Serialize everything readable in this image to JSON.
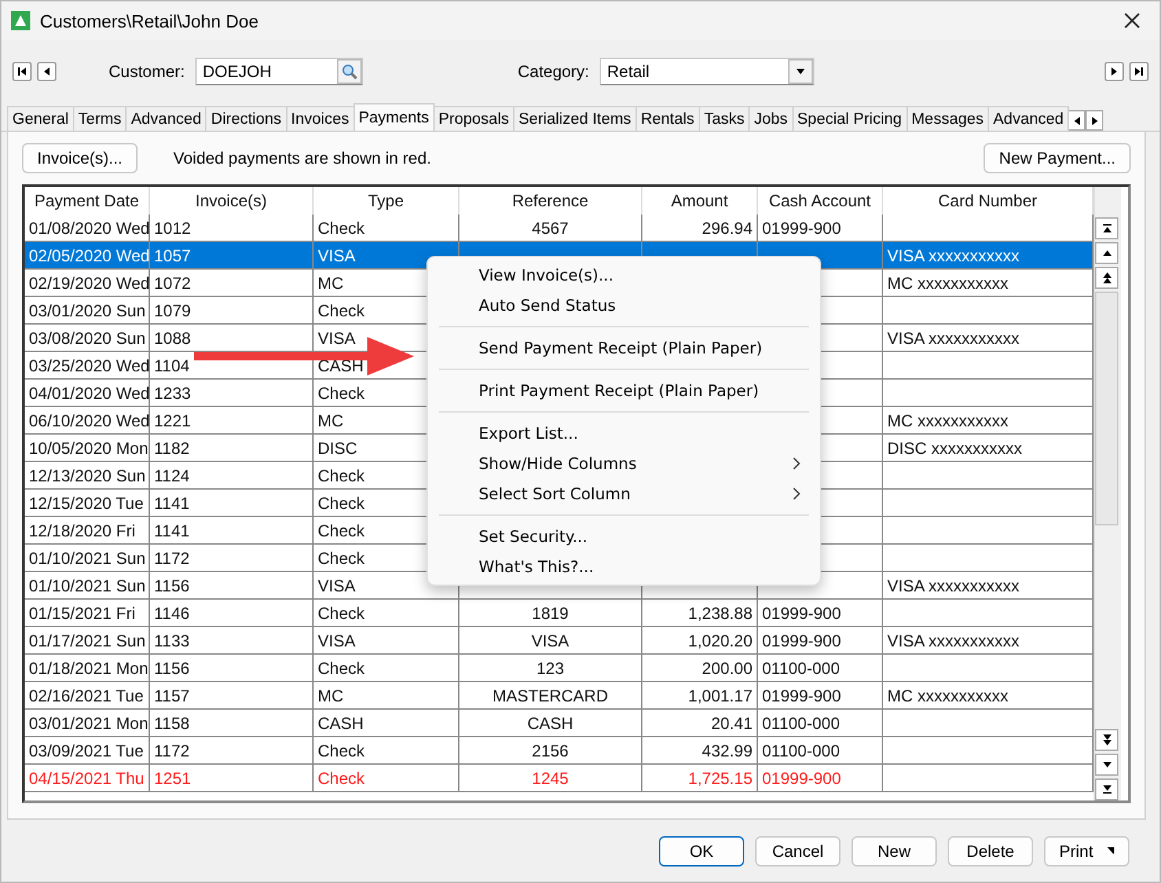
{
  "window": {
    "title": "Customers\\Retail\\John Doe"
  },
  "customer": {
    "label": "Customer:",
    "value": "DOEJOH"
  },
  "category": {
    "label": "Category:",
    "value": "Retail"
  },
  "tabs": [
    {
      "label": "General",
      "selected": false
    },
    {
      "label": "Terms",
      "selected": false
    },
    {
      "label": "Advanced",
      "selected": false
    },
    {
      "label": "Directions",
      "selected": false
    },
    {
      "label": "Invoices",
      "selected": false
    },
    {
      "label": "Payments",
      "selected": true
    },
    {
      "label": "Proposals",
      "selected": false
    },
    {
      "label": "Serialized Items",
      "selected": false
    },
    {
      "label": "Rentals",
      "selected": false
    },
    {
      "label": "Tasks",
      "selected": false
    },
    {
      "label": "Jobs",
      "selected": false
    },
    {
      "label": "Special Pricing",
      "selected": false
    },
    {
      "label": "Messages",
      "selected": false
    },
    {
      "label": "Advanced",
      "selected": false
    }
  ],
  "invoices_button": "Invoice(s)...",
  "note": "Voided payments are shown in red.",
  "new_payment_button": "New Payment...",
  "table": {
    "columns": [
      "Payment Date",
      "Invoice(s)",
      "Type",
      "Reference",
      "Amount",
      "Cash Account",
      "Card Number"
    ],
    "rows": [
      {
        "selected": false,
        "voided": false,
        "date": "01/08/2020 Wed",
        "invoice": "1012",
        "type": "Check",
        "reference": "4567",
        "amount": "296.94",
        "cash_account": "01999-900"
      },
      {
        "selected": true,
        "voided": false,
        "date": "02/05/2020 Wed",
        "invoice": "1057",
        "type": "VISA",
        "card_number": "VISA xxxxxxxxxxx"
      },
      {
        "selected": false,
        "voided": false,
        "date": "02/19/2020 Wed",
        "invoice": "1072",
        "type": "MC",
        "card_number": "MC xxxxxxxxxxx"
      },
      {
        "selected": false,
        "voided": false,
        "date": "03/01/2020 Sun",
        "invoice": "1079",
        "type": "Check"
      },
      {
        "selected": false,
        "voided": false,
        "date": "03/08/2020 Sun",
        "invoice": "1088",
        "type": "VISA",
        "card_number": "VISA xxxxxxxxxxx"
      },
      {
        "selected": false,
        "voided": false,
        "date": "03/25/2020 Wed",
        "invoice": "1104",
        "type": "CASH"
      },
      {
        "selected": false,
        "voided": false,
        "date": "04/01/2020 Wed",
        "invoice": "1233",
        "type": "Check"
      },
      {
        "selected": false,
        "voided": false,
        "date": "06/10/2020 Wed",
        "invoice": "1221",
        "type": "MC",
        "card_number": "MC xxxxxxxxxxx"
      },
      {
        "selected": false,
        "voided": false,
        "date": "10/05/2020 Mon",
        "invoice": "1182",
        "type": "DISC",
        "card_number": "DISC xxxxxxxxxxx"
      },
      {
        "selected": false,
        "voided": false,
        "date": "12/13/2020 Sun",
        "invoice": "1124",
        "type": "Check"
      },
      {
        "selected": false,
        "voided": false,
        "date": "12/15/2020 Tue",
        "invoice": "1141",
        "type": "Check"
      },
      {
        "selected": false,
        "voided": false,
        "date": "12/18/2020 Fri",
        "invoice": "1141",
        "type": "Check"
      },
      {
        "selected": false,
        "voided": false,
        "date": "01/10/2021 Sun",
        "invoice": "1172",
        "type": "Check"
      },
      {
        "selected": false,
        "voided": false,
        "date": "01/10/2021 Sun",
        "invoice": "1156",
        "type": "VISA",
        "card_number": "VISA xxxxxxxxxxx"
      },
      {
        "selected": false,
        "voided": false,
        "date": "01/15/2021 Fri",
        "invoice": "1146",
        "type": "Check",
        "reference": "1819",
        "amount": "1,238.88",
        "cash_account": "01999-900"
      },
      {
        "selected": false,
        "voided": false,
        "date": "01/17/2021 Sun",
        "invoice": "1133",
        "type": "VISA",
        "reference": "VISA",
        "amount": "1,020.20",
        "cash_account": "01999-900",
        "card_number": "VISA xxxxxxxxxxx"
      },
      {
        "selected": false,
        "voided": false,
        "date": "01/18/2021 Mon",
        "invoice": "1156",
        "type": "Check",
        "reference": "123",
        "amount": "200.00",
        "cash_account": "01100-000"
      },
      {
        "selected": false,
        "voided": false,
        "date": "02/16/2021 Tue",
        "invoice": "1157",
        "type": "MC",
        "reference": "MASTERCARD",
        "amount": "1,001.17",
        "cash_account": "01999-900",
        "card_number": "MC xxxxxxxxxxx"
      },
      {
        "selected": false,
        "voided": false,
        "date": "03/01/2021 Mon",
        "invoice": "1158",
        "type": "CASH",
        "reference": "CASH",
        "amount": "20.41",
        "cash_account": "01100-000"
      },
      {
        "selected": false,
        "voided": false,
        "date": "03/09/2021 Tue",
        "invoice": "1172",
        "type": "Check",
        "reference": "2156",
        "amount": "432.99",
        "cash_account": "01100-000"
      },
      {
        "selected": false,
        "voided": true,
        "date": "04/15/2021 Thu",
        "invoice": "1251",
        "type": "Check",
        "reference": "1245",
        "amount": "1,725.15",
        "cash_account": "01999-900"
      }
    ]
  },
  "context_menu": {
    "groups": [
      [
        {
          "label": "View Invoice(s)...",
          "submenu": false
        },
        {
          "label": "Auto Send Status",
          "submenu": false
        }
      ],
      [
        {
          "label": "Send Payment Receipt (Plain Paper)",
          "submenu": false
        }
      ],
      [
        {
          "label": "Print Payment Receipt (Plain Paper)",
          "submenu": false
        }
      ],
      [
        {
          "label": "Export List...",
          "submenu": false
        },
        {
          "label": "Show/Hide Columns",
          "submenu": true
        },
        {
          "label": "Select Sort Column",
          "submenu": true
        }
      ],
      [
        {
          "label": "Set Security...",
          "submenu": false
        },
        {
          "label": "What's This?...",
          "submenu": false
        }
      ]
    ]
  },
  "buttons": [
    {
      "label": "OK",
      "kind": "default"
    },
    {
      "label": "Cancel",
      "kind": "plain"
    },
    {
      "label": "New",
      "kind": "plain"
    },
    {
      "label": "Delete",
      "kind": "plain"
    },
    {
      "label": "Print",
      "kind": "dropdown"
    }
  ]
}
